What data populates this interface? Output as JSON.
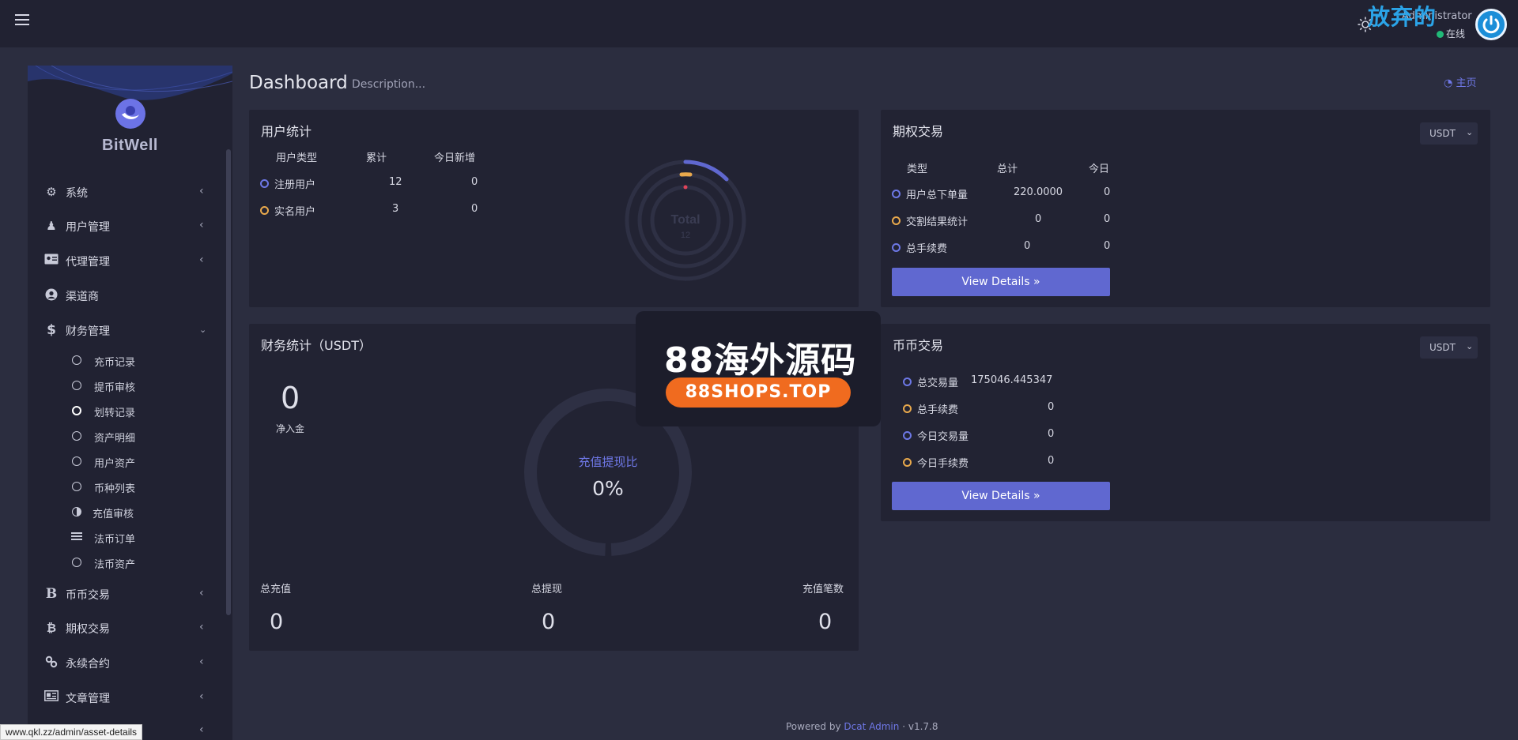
{
  "topbar": {
    "user_name": "Administrator",
    "status": "在线",
    "watermark_top": "放弃的"
  },
  "sidebar": {
    "brand": "BitWell",
    "menu": [
      {
        "label": "系统",
        "icon": "gear-icon"
      },
      {
        "label": "用户管理",
        "icon": "user-icon"
      },
      {
        "label": "代理管理",
        "icon": "id-card-icon"
      },
      {
        "label": "渠道商",
        "icon": "user-circle-icon"
      },
      {
        "label": "财务管理",
        "icon": "dollar-icon"
      }
    ],
    "finance_sub": [
      {
        "label": "充币记录"
      },
      {
        "label": "提币审核"
      },
      {
        "label": "划转记录"
      },
      {
        "label": "资产明细"
      },
      {
        "label": "用户资产"
      },
      {
        "label": "币种列表"
      },
      {
        "label": "充值审核"
      },
      {
        "label": "法币订单"
      },
      {
        "label": "法币资产"
      }
    ],
    "menu_bottom": [
      {
        "label": "币币交易",
        "icon": "bold-b-icon"
      },
      {
        "label": "期权交易",
        "icon": "bitcoin-icon"
      },
      {
        "label": "永续合约",
        "icon": "link-icon"
      },
      {
        "label": "文章管理",
        "icon": "newspaper-icon"
      }
    ]
  },
  "status_url": "www.qkl.zz/admin/asset-details",
  "header": {
    "title": "Dashboard",
    "description": "Description...",
    "home": "主页"
  },
  "user_stats": {
    "title": "用户统计",
    "columns": [
      "用户类型",
      "累计",
      "今日新增"
    ],
    "rows": [
      {
        "label": "注册用户",
        "total": "12",
        "today": "0"
      },
      {
        "label": "实名用户",
        "total": "3",
        "today": "0"
      }
    ],
    "ring_label": "Total",
    "ring_value": "12"
  },
  "options": {
    "title": "期权交易",
    "select": "USDT",
    "columns": [
      "类型",
      "总计",
      "今日"
    ],
    "rows": [
      {
        "label": "用户总下单量",
        "total": "220.0000",
        "today": "0"
      },
      {
        "label": "交割结果统计",
        "total": "0",
        "today": "0"
      },
      {
        "label": "总手续费",
        "total": "0",
        "today": "0"
      }
    ],
    "button": "View Details »"
  },
  "finance": {
    "title": "财务统计（USDT）",
    "net_value": "0",
    "net_label": "净入金",
    "ring_label": "充值提现比",
    "ring_value": "0%",
    "stats": [
      {
        "label": "总充值",
        "value": "0"
      },
      {
        "label": "总提现",
        "value": "0"
      },
      {
        "label": "充值笔数",
        "value": "0"
      }
    ]
  },
  "coin": {
    "title": "币币交易",
    "select": "USDT",
    "rows": [
      {
        "label": "总交易量",
        "value": "175046.445347"
      },
      {
        "label": "总手续费",
        "value": "0"
      },
      {
        "label": "今日交易量",
        "value": "0"
      },
      {
        "label": "今日手续费",
        "value": "0"
      }
    ],
    "button": "View Details »"
  },
  "footer": {
    "powered": "Powered by",
    "link": "Dcat Admin",
    "sep": "·",
    "version": "v1.7.8"
  },
  "watermark": {
    "main": "88海外源码",
    "pill": "88SHOPS.TOP"
  }
}
